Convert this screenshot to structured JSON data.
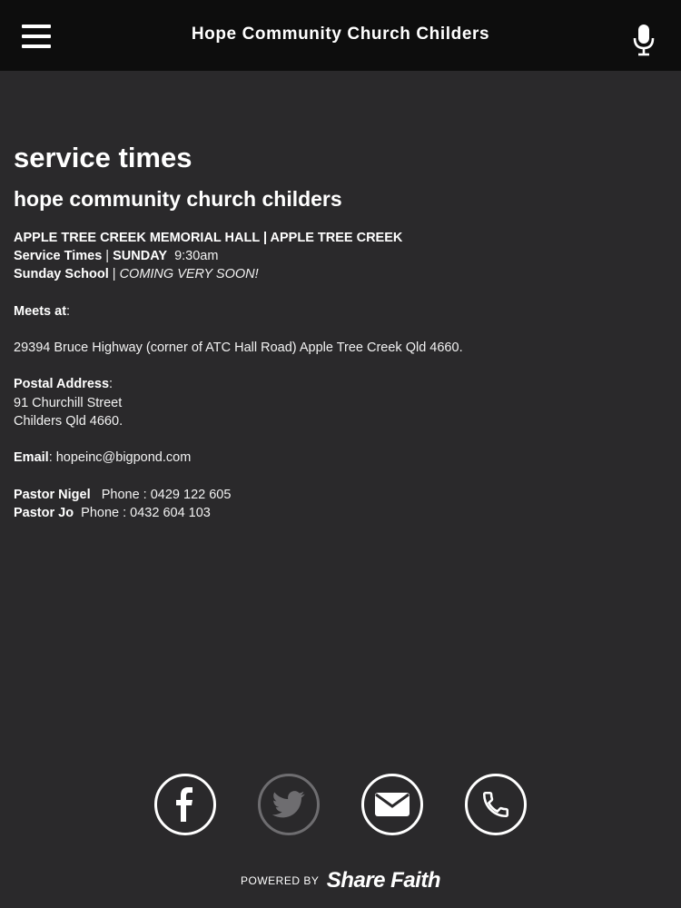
{
  "header": {
    "title": "Hope Community Church Childers",
    "menu_icon": "hamburger-menu-icon",
    "mic_icon": "microphone-icon"
  },
  "main": {
    "page_title": "service times",
    "subtitle": "hope community church childers",
    "venue": "APPLE TREE CREEK MEMORIAL HALL | APPLE TREE CREEK",
    "service_times_label": "Service Times",
    "service_separator": " | ",
    "service_day": "SUNDAY",
    "service_time": "9:30am",
    "sunday_school_label": "Sunday School",
    "sunday_school_separator": " | ",
    "sunday_school_value": "COMING VERY SOON!",
    "meets_at_label": "Meets at",
    "meets_at_colon": ":",
    "address": "29394 Bruce Highway (corner of ATC Hall Road) Apple Tree Creek Qld 4660.",
    "postal_label": "Postal Address",
    "postal_colon": ":",
    "postal_line1": "91 Churchill Street",
    "postal_line2": "Childers Qld 4660.",
    "email_label": "Email",
    "email_value": ": hopeinc@bigpond.com",
    "pastor1_name": "Pastor Nigel",
    "pastor1_phone": "Phone : 0429 122 605",
    "pastor2_name": "Pastor Jo",
    "pastor2_phone": "Phone :  0432 604 103"
  },
  "footer": {
    "social_icons": [
      "facebook-icon",
      "twitter-icon",
      "email-icon",
      "phone-icon"
    ],
    "powered_by": "POWERED BY",
    "brand": "Share Faith",
    "colors": {
      "active": "#ffffff",
      "muted": "#6e6d70"
    }
  },
  "colors": {
    "header_bg": "#0d0d0d",
    "page_bg": "#2a292b",
    "text": "#ffffff"
  }
}
